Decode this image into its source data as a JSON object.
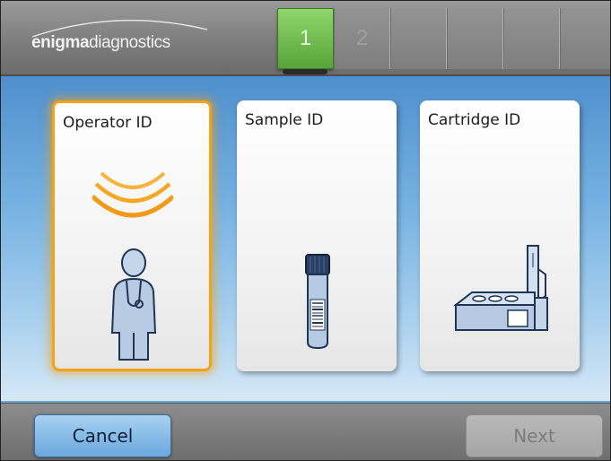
{
  "header": {
    "logo_part1": "enigma",
    "logo_part2": "diagnostics",
    "steps": [
      "1",
      "2",
      "",
      "",
      "",
      ""
    ],
    "active_step": "1"
  },
  "cards": [
    {
      "title": "Operator ID",
      "icon": "operator-icon",
      "selected": true
    },
    {
      "title": "Sample ID",
      "icon": "sample-tube-icon",
      "selected": false
    },
    {
      "title": "Cartridge ID",
      "icon": "cartridge-icon",
      "selected": false
    }
  ],
  "footer": {
    "cancel_label": "Cancel",
    "next_label": "Next"
  },
  "colors": {
    "accent_selected": "#f2a31a",
    "step_active": "#6fbf4c",
    "button_blue": "#8cc0ea"
  }
}
